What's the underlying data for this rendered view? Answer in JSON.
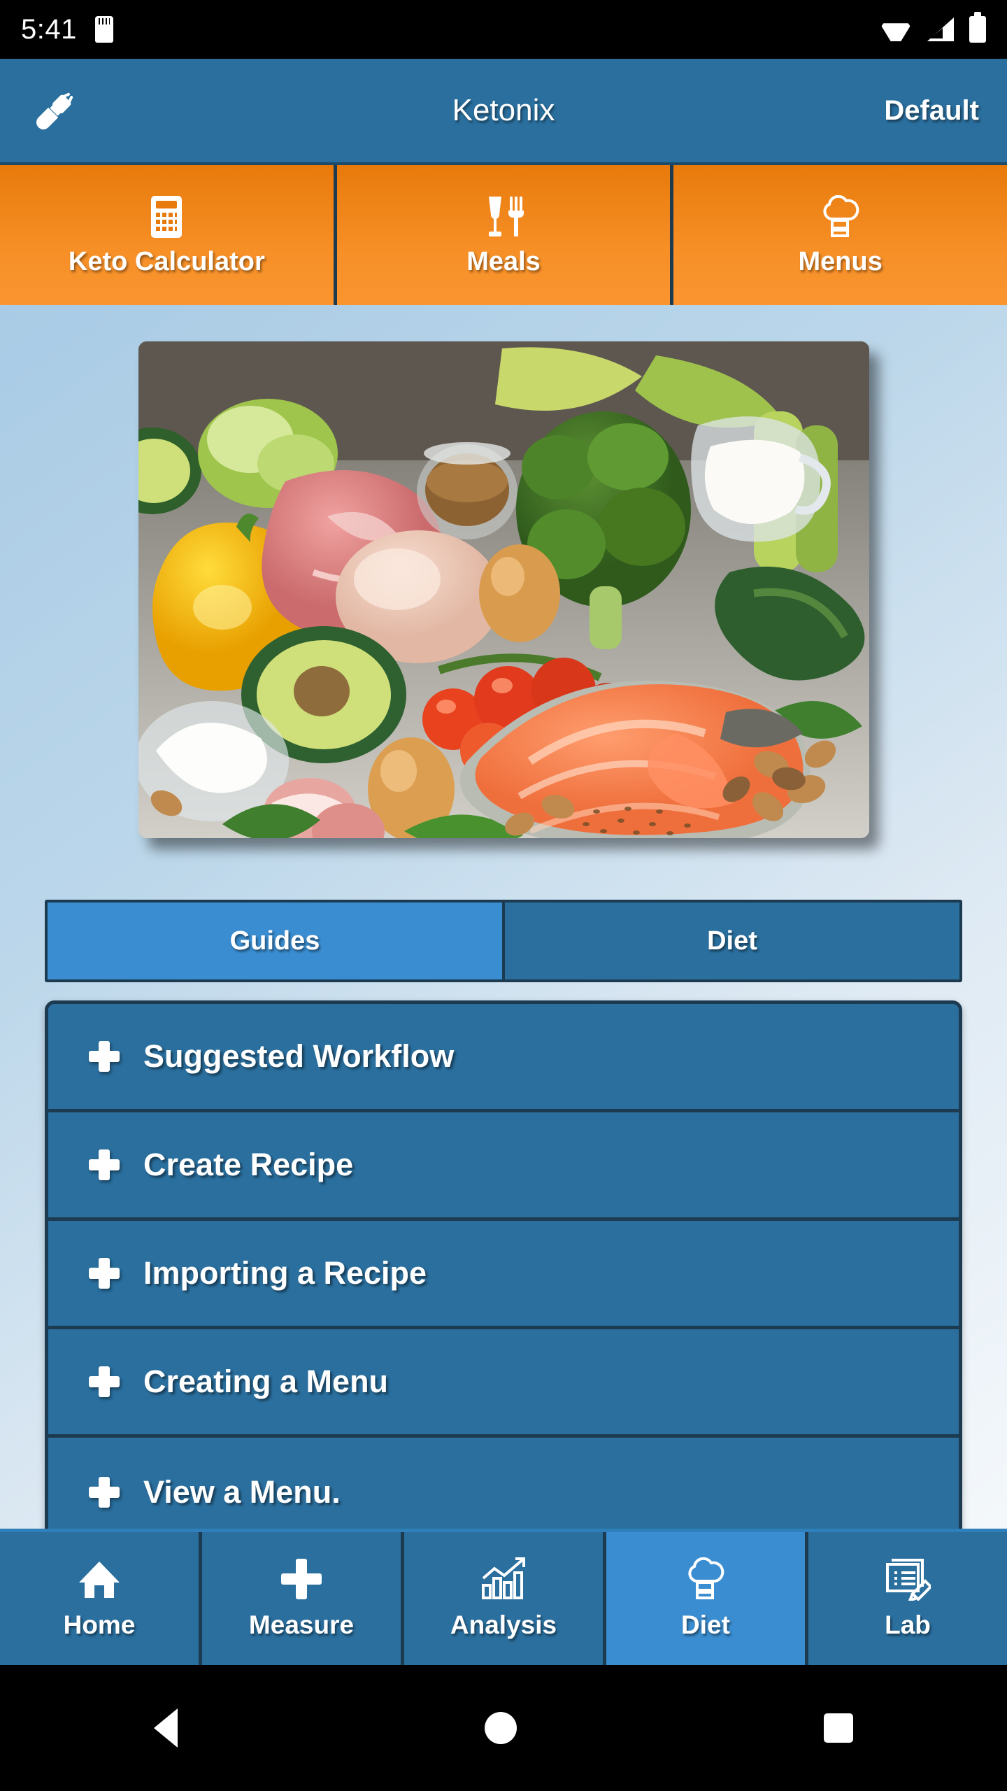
{
  "status_bar": {
    "time": "5:41",
    "left_icons": [
      "sd-card-icon"
    ],
    "right_icons": [
      "wifi-icon",
      "cellular-signal-icon",
      "battery-icon"
    ]
  },
  "app_bar": {
    "left_icon": "disconnected-plug-icon",
    "title": "Ketonix",
    "right_label": "Default",
    "background_color": "#2a6f9e"
  },
  "top_tabs": {
    "background_color": "#f68f26",
    "items": [
      {
        "label": "Keto Calculator",
        "icon": "calculator-icon"
      },
      {
        "label": "Meals",
        "icon": "glass-and-fork-icon"
      },
      {
        "label": "Menus",
        "icon": "chef-hat-icon"
      }
    ]
  },
  "hero": {
    "image_alt": "keto-foods-photo",
    "description": "Assorted keto foods: salmon steak, broccoli, avocado, yellow bell pepper, eggs, cherry tomatoes on the vine, raw beef, chicken breast, bacon rolls, cream pitcher, zucchini, spinach, nuts and seeds on a grey table"
  },
  "sub_tabs": {
    "items": [
      {
        "label": "Guides",
        "active": true
      },
      {
        "label": "Diet",
        "active": false
      }
    ],
    "active_color": "#3a8dd0",
    "inactive_color": "#2a6f9e"
  },
  "accordion": {
    "items": [
      {
        "label": "Suggested Workflow",
        "icon": "plus-icon",
        "expanded": false
      },
      {
        "label": "Create Recipe",
        "icon": "plus-icon",
        "expanded": false
      },
      {
        "label": "Importing a Recipe",
        "icon": "plus-icon",
        "expanded": false
      },
      {
        "label": "Creating a Menu",
        "icon": "plus-icon",
        "expanded": false
      },
      {
        "label": "View a Menu.",
        "icon": "plus-icon",
        "expanded": false
      }
    ]
  },
  "bottom_nav": {
    "items": [
      {
        "label": "Home",
        "icon": "home-icon",
        "active": false
      },
      {
        "label": "Measure",
        "icon": "plus-icon",
        "active": false
      },
      {
        "label": "Analysis",
        "icon": "bar-chart-trend-icon",
        "active": false
      },
      {
        "label": "Diet",
        "icon": "chef-hat-icon",
        "active": true
      },
      {
        "label": "Lab",
        "icon": "document-pencil-icon",
        "active": false
      }
    ],
    "active_color": "#3a8dd0"
  },
  "android_nav": {
    "buttons": [
      "back-button",
      "home-button",
      "recents-button"
    ]
  }
}
